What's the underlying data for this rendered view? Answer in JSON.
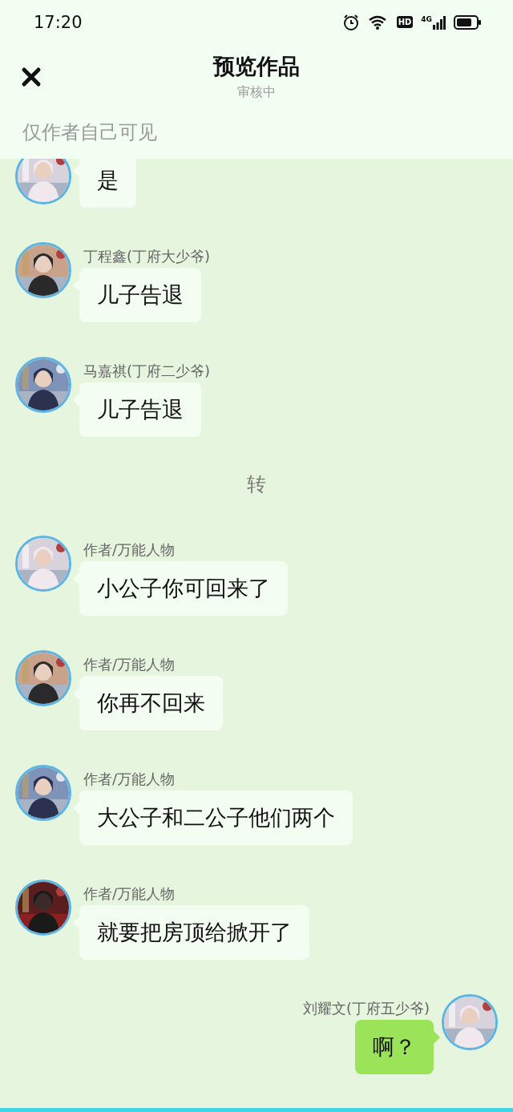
{
  "status_bar": {
    "time": "17:20",
    "hd": "HD",
    "network": "4G"
  },
  "header": {
    "title": "预览作品",
    "subtitle": "审核中",
    "notice": "仅作者自己可见"
  },
  "messages": [
    {
      "kind": "incoming",
      "text": "是"
    },
    {
      "kind": "incoming",
      "name": "丁程鑫(丁府大少爷)",
      "text": "儿子告退"
    },
    {
      "kind": "incoming",
      "name": "马嘉祺(丁府二少爷)",
      "text": "儿子告退"
    },
    {
      "kind": "system",
      "text": "转"
    },
    {
      "kind": "incoming",
      "name": "作者/万能人物",
      "text": "小公子你可回来了"
    },
    {
      "kind": "incoming",
      "name": "作者/万能人物",
      "text": "你再不回来"
    },
    {
      "kind": "incoming",
      "name": "作者/万能人物",
      "text": "大公子和二公子他们两个"
    },
    {
      "kind": "incoming",
      "name": "作者/万能人物",
      "text": "就要把房顶给掀开了"
    },
    {
      "kind": "outgoing",
      "name": "刘耀文(丁府五少爷)",
      "text": "啊？"
    }
  ]
}
